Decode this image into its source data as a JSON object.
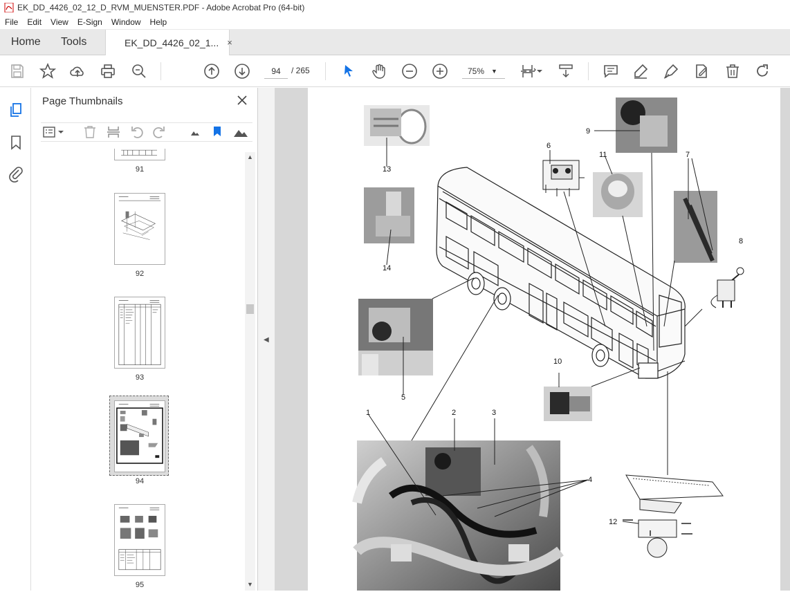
{
  "window": {
    "title": "EK_DD_4426_02_12_D_RVM_MUENSTER.PDF - Adobe Acrobat Pro (64-bit)"
  },
  "menu": [
    "File",
    "Edit",
    "View",
    "E-Sign",
    "Window",
    "Help"
  ],
  "tabs": {
    "home": "Home",
    "tools": "Tools",
    "document": "EK_DD_4426_02_1...",
    "close": "×"
  },
  "toolbar": {
    "page_current": "94",
    "page_total": "/ 265",
    "zoom": "75%"
  },
  "panel": {
    "title": "Page Thumbnails",
    "thumbnails": [
      {
        "label": "91"
      },
      {
        "label": "92"
      },
      {
        "label": "93"
      },
      {
        "label": "94",
        "selected": true
      },
      {
        "label": "95"
      }
    ]
  },
  "diagram": {
    "callouts": [
      "1",
      "2",
      "3",
      "4",
      "5",
      "6",
      "7",
      "8",
      "9",
      "10",
      "11",
      "12",
      "13",
      "14"
    ]
  },
  "colors": {
    "accent": "#1473e6",
    "chrome": "#e9e9e9",
    "docbg": "#d7d7d7"
  }
}
